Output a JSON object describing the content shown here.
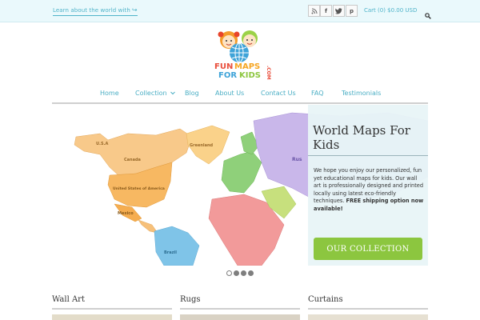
{
  "topbar": {
    "promo_text": "Learn about the world with",
    "promo_arrow": "↪",
    "social": [
      {
        "name": "rss-icon",
        "glyph": "ʀ"
      },
      {
        "name": "facebook-icon",
        "glyph": "f"
      },
      {
        "name": "twitter-icon",
        "glyph": "t"
      },
      {
        "name": "pinterest-icon",
        "glyph": "p"
      }
    ],
    "cart_text": "Cart (0) $0.00 USD",
    "search_icon": "search-icon"
  },
  "logo": {
    "line1_a": "FUN",
    "line1_b": "MAPS",
    "line2_a": "FOR",
    "line2_b": "KIDS",
    "dotcom": ".COM"
  },
  "nav": {
    "items": [
      {
        "label": "Home"
      },
      {
        "label": "Collection",
        "has_dropdown": true
      },
      {
        "label": "Blog"
      },
      {
        "label": "About Us"
      },
      {
        "label": "Contact Us"
      },
      {
        "label": "FAQ"
      },
      {
        "label": "Testimonials"
      }
    ]
  },
  "hero": {
    "title": "World Maps For Kids",
    "text_plain": "We hope you enjoy our personalized, fun yet educational maps for kids. Our wall art is professionally designed and printed locally using latest eco-friendly techniques.",
    "text_bold": "FREE shipping option now available!",
    "button_label": "OUR COLLECTION",
    "map_labels": {
      "usa": "U.S.A",
      "canada": "Canada",
      "greenland": "Greenland",
      "united_states": "United States of America",
      "mexico": "Mexico",
      "brazil": "Brazil",
      "russia": "Rus"
    }
  },
  "slider": {
    "dot_count": 4,
    "active_index": 0
  },
  "categories": [
    {
      "label": "Wall Art"
    },
    {
      "label": "Rugs"
    },
    {
      "label": "Curtains"
    }
  ],
  "colors": {
    "accent": "#4fb3c9",
    "button_green": "#8cc63f",
    "topbar_bg": "#eaf9fc"
  }
}
